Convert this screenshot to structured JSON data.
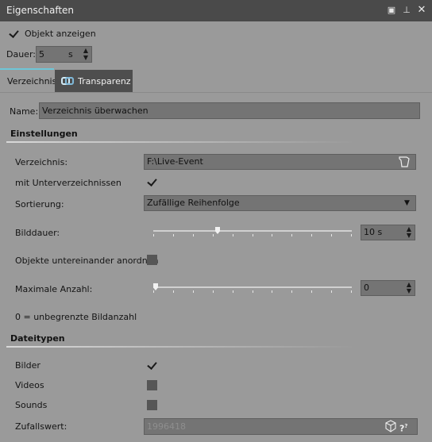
{
  "window": {
    "title": "Eigenschaften"
  },
  "top": {
    "show_object_label": "Objekt anzeigen",
    "show_object_checked": true,
    "duration_label": "Dauer:",
    "duration_value": "5",
    "duration_unit": "s"
  },
  "tabs": [
    {
      "label": "Verzeichnis",
      "active": true
    },
    {
      "label": "Transparenz",
      "active": false
    }
  ],
  "name": {
    "label": "Name:",
    "value": "Verzeichnis überwachen"
  },
  "settings": {
    "header": "Einstellungen",
    "directory_label": "Verzeichnis:",
    "directory_value": "F:\\Live-Event",
    "subdirs_label": "mit Unterverzeichnissen",
    "subdirs_checked": true,
    "sort_label": "Sortierung:",
    "sort_value": "Zufällige Reihenfolge",
    "image_duration_label": "Bilddauer:",
    "image_duration_value": "10 s",
    "image_duration_slider_fraction": 0.32,
    "arrange_label": "Objekte untereinander anordnen",
    "arrange_checked": false,
    "max_count_label": "Maximale Anzahl:",
    "max_count_value": "0",
    "max_count_slider_fraction": 0.0,
    "hint": "0 = unbegrenzte Bildanzahl"
  },
  "filetypes": {
    "header": "Dateitypen",
    "images_label": "Bilder",
    "images_checked": true,
    "videos_label": "Videos",
    "videos_checked": false,
    "sounds_label": "Sounds",
    "sounds_checked": false,
    "random_label": "Zufallswert:",
    "random_placeholder": "1996418"
  },
  "icons": [
    "restore-icon",
    "pin-icon",
    "close-icon",
    "checkbox-icon",
    "spin-up-icon",
    "spin-down-icon",
    "transparency-icon",
    "folder-browse-icon",
    "dropdown-arrow-icon",
    "dice-icon",
    "help-icon"
  ]
}
